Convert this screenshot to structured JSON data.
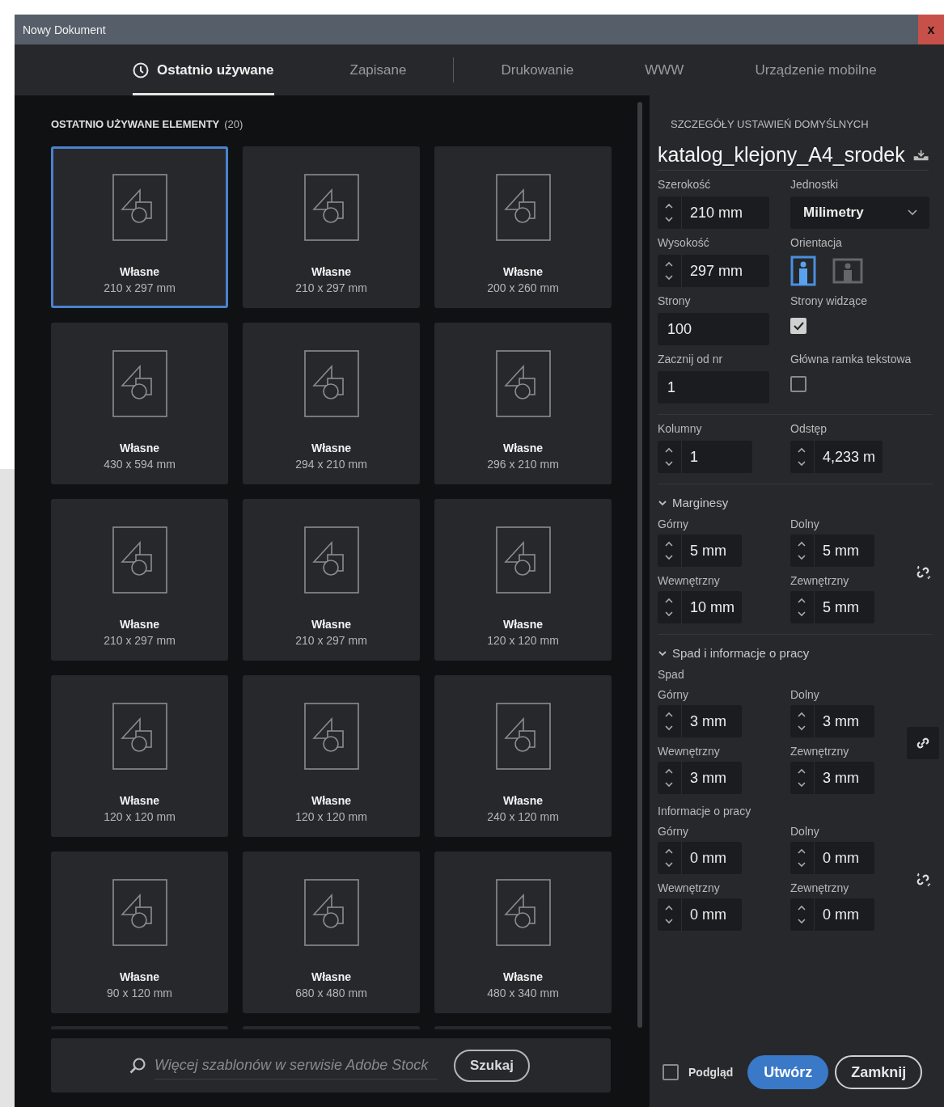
{
  "window": {
    "title": "Nowy Dokument",
    "close_label": "x"
  },
  "tabs": [
    {
      "label": "Ostatnio używane",
      "selected": true,
      "kind": "icon"
    },
    {
      "label": "Zapisane",
      "selected": false,
      "kind": "plain",
      "divider_after": true
    },
    {
      "label": "Drukowanie",
      "selected": false,
      "kind": "plain"
    },
    {
      "label": "WWW",
      "selected": false,
      "kind": "plain"
    },
    {
      "label": "Urządzenie mobilne",
      "selected": false,
      "kind": "plain"
    }
  ],
  "recent": {
    "heading": "OSTATNIO UŻYWANE ELEMENTY",
    "count": "(20)",
    "tiles": [
      {
        "name": "Własne",
        "size": "210 x 297 mm",
        "selected": true
      },
      {
        "name": "Własne",
        "size": "210 x 297 mm",
        "selected": false
      },
      {
        "name": "Własne",
        "size": "200 x 260 mm",
        "selected": false
      },
      {
        "name": "Własne",
        "size": "430 x 594 mm",
        "selected": false
      },
      {
        "name": "Własne",
        "size": "294 x 210 mm",
        "selected": false
      },
      {
        "name": "Własne",
        "size": "296 x 210 mm",
        "selected": false
      },
      {
        "name": "Własne",
        "size": "210 x 297 mm",
        "selected": false
      },
      {
        "name": "Własne",
        "size": "210 x 297 mm",
        "selected": false
      },
      {
        "name": "Własne",
        "size": "120 x 120 mm",
        "selected": false
      },
      {
        "name": "Własne",
        "size": "120 x 120 mm",
        "selected": false
      },
      {
        "name": "Własne",
        "size": "120 x 120 mm",
        "selected": false
      },
      {
        "name": "Własne",
        "size": "240 x 120 mm",
        "selected": false
      },
      {
        "name": "Własne",
        "size": "90 x 120 mm",
        "selected": false
      },
      {
        "name": "Własne",
        "size": "680 x 480 mm",
        "selected": false
      },
      {
        "name": "Własne",
        "size": "480 x 340 mm",
        "selected": false
      }
    ]
  },
  "search": {
    "placeholder": "Więcej szablonów w serwisie Adobe Stock",
    "button": "Szukaj"
  },
  "details": {
    "heading": "SZCZEGÓŁY USTAWIEŃ DOMYŚLNYCH",
    "preset_name": "katalog_klejony_A4_srodek",
    "width": {
      "label": "Szerokość",
      "value": "210 mm"
    },
    "units": {
      "label": "Jednostki",
      "value": "Milimetry"
    },
    "height": {
      "label": "Wysokość",
      "value": "297 mm"
    },
    "orientation": {
      "label": "Orientacja",
      "options": [
        {
          "kind": "portrait",
          "selected": true
        },
        {
          "kind": "landscape",
          "selected": false
        }
      ]
    },
    "pages": {
      "label": "Strony",
      "value": "100"
    },
    "facing_pages": {
      "label": "Strony widzące",
      "checked": true
    },
    "start_number": {
      "label": "Zacznij od nr",
      "value": "1"
    },
    "primary_text_frame": {
      "label": "Główna ramka tekstowa",
      "checked": false
    },
    "columns": {
      "label": "Kolumny",
      "value": "1"
    },
    "gutter": {
      "label": "Odstęp",
      "value": "4,233 m"
    },
    "margins": {
      "title": "Marginesy",
      "expanded": true,
      "linked": false,
      "fields": [
        {
          "label": "Górny",
          "value": "5 mm"
        },
        {
          "label": "Dolny",
          "value": "5 mm"
        },
        {
          "label": "Wewnętrzny",
          "value": "10 mm"
        },
        {
          "label": "Zewnętrzny",
          "value": "5 mm"
        }
      ]
    },
    "bleed_slug": {
      "title": "Spad i informacje o pracy",
      "expanded": true,
      "groups": [
        {
          "label": "Spad",
          "linked": true,
          "fields": [
            {
              "label": "Górny",
              "value": "3 mm"
            },
            {
              "label": "Dolny",
              "value": "3 mm"
            },
            {
              "label": "Wewnętrzny",
              "value": "3 mm"
            },
            {
              "label": "Zewnętrzny",
              "value": "3 mm"
            }
          ]
        },
        {
          "label": "Informacje o pracy",
          "linked": false,
          "fields": [
            {
              "label": "Górny",
              "value": "0 mm"
            },
            {
              "label": "Dolny",
              "value": "0 mm"
            },
            {
              "label": "Wewnętrzny",
              "value": "0 mm"
            },
            {
              "label": "Zewnętrzny",
              "value": "0 mm"
            }
          ]
        }
      ]
    }
  },
  "footer": {
    "preview_label": "Podgląd",
    "preview_checked": false,
    "create": "Utwórz",
    "close": "Zamknij"
  }
}
